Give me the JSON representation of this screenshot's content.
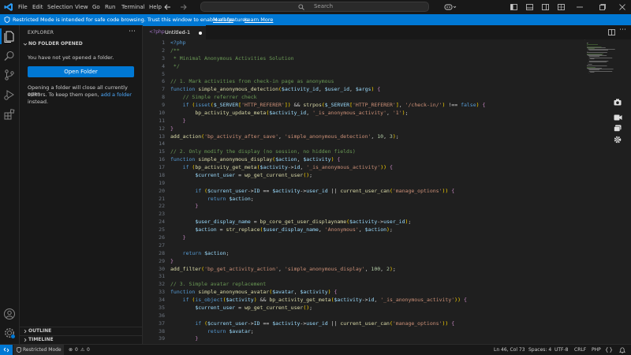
{
  "menu": [
    "File",
    "Edit",
    "Selection",
    "View",
    "Go",
    "Run",
    "Terminal",
    "Help"
  ],
  "search": {
    "text": "Search"
  },
  "banner": {
    "message": "Restricted Mode is intended for safe code browsing. Trust this window to enable all features.",
    "manage": "Manage",
    "learn_more": "Learn More"
  },
  "sidebar": {
    "title": "EXPLORER",
    "section": "NO FOLDER OPENED",
    "no_folder": "You have not yet opened a folder.",
    "button": "Open Folder",
    "hint1": "Opening a folder will close all currently open",
    "hint2": "editors. To keep them open,",
    "hint_link": "add a folder",
    "hint3": "instead.",
    "outline": "OUTLINE",
    "timeline": "TIMELINE"
  },
  "tab": {
    "icon": "<?php",
    "name": "Untitled-1"
  },
  "status": {
    "restricted": "Restricted Mode",
    "problems": "0",
    "warnings": "0",
    "position": "Ln 46, Col 73",
    "spaces": "Spaces: 4",
    "encoding": "UTF-8",
    "eol": "CRLF",
    "language": "PHP"
  },
  "lines": [
    "<?php",
    "/**",
    " * Minimal Anonymous Activities Solution",
    " */",
    "",
    "// 1. Mark activities from check-in page as anonymous",
    "function simple_anonymous_detection($activity_id, $user_id, $args) {",
    "    // Simple referrer check",
    "    if (isset($_SERVER['HTTP_REFERER']) && strpos($_SERVER['HTTP_REFERER'], '/check-in/') !== false) {",
    "        bp_activity_update_meta($activity_id, '_is_anonymous_activity', '1');",
    "    }",
    "}",
    "add_action('bp_activity_after_save', 'simple_anonymous_detection', 10, 3);",
    "",
    "// 2. Only modify the display (no session, no hidden fields)",
    "function simple_anonymous_display($action, $activity) {",
    "    if (bp_activity_get_meta($activity->id, '_is_anonymous_activity')) {",
    "        $current_user = wp_get_current_user();",
    "",
    "        if ($current_user->ID == $activity->user_id || current_user_can('manage_options')) {",
    "            return $action;",
    "        }",
    "",
    "        $user_display_name = bp_core_get_user_displayname($activity->user_id);",
    "        $action = str_replace($user_display_name, 'Anonymous', $action);",
    "    }",
    "",
    "    return $action;",
    "}",
    "add_filter('bp_get_activity_action', 'simple_anonymous_display', 100, 2);",
    "",
    "// 3. Simple avatar replacement",
    "function simple_anonymous_avatar($avatar, $activity) {",
    "    if (is_object($activity) && bp_activity_get_meta($activity->id, '_is_anonymous_activity')) {",
    "        $current_user = wp_get_current_user();",
    "",
    "        if ($current_user->ID == $activity->user_id || current_user_can('manage_options')) {",
    "            return $avatar;",
    "        }"
  ]
}
